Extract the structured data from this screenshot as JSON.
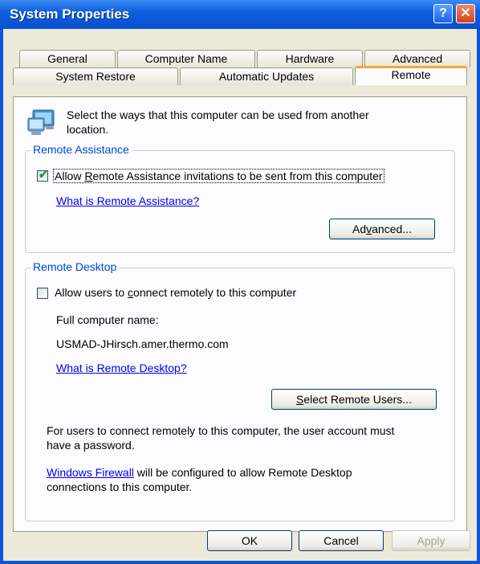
{
  "window": {
    "title": "System Properties",
    "help_glyph": "?",
    "close_glyph": "✕"
  },
  "tabs_row1": [
    {
      "label": "General"
    },
    {
      "label": "Computer Name"
    },
    {
      "label": "Hardware"
    },
    {
      "label": "Advanced"
    }
  ],
  "tabs_row2": [
    {
      "label": "System Restore"
    },
    {
      "label": "Automatic Updates"
    },
    {
      "label": "Remote",
      "selected": true
    }
  ],
  "intro": {
    "line1": "Select the ways that this computer can be used from another",
    "line2": "location.",
    "icon": "remote-computer-icon"
  },
  "remote_assistance": {
    "group_label": "Remote Assistance",
    "checkbox_pre": "Allow ",
    "checkbox_mn": "R",
    "checkbox_post": "emote Assistance invitations to be sent from this computer",
    "checked": true,
    "link": "What is Remote Assistance?",
    "advanced_pre": "Ad",
    "advanced_mn": "v",
    "advanced_post": "anced..."
  },
  "remote_desktop": {
    "group_label": "Remote Desktop",
    "checkbox_pre": "Allow users to ",
    "checkbox_mn": "c",
    "checkbox_post": "onnect remotely to this computer",
    "checked": false,
    "full_name_label": "Full computer name:",
    "full_name_value": "USMAD-JHirsch.amer.thermo.com",
    "link": "What is Remote Desktop?",
    "select_pre": "",
    "select_mn": "S",
    "select_post": "elect Remote Users...",
    "note_line1": "For users to connect remotely to this computer, the user account must",
    "note_line2": "have a password.",
    "firewall_link": "Windows Firewall",
    "firewall_rest": " will be configured to allow Remote Desktop",
    "firewall_line2": "connections to this computer."
  },
  "footer": {
    "ok": "OK",
    "cancel": "Cancel",
    "apply": "Apply"
  },
  "colors": {
    "title_bar": "#0a56d8",
    "group_label": "#0046d5",
    "tab_highlight": "#f3a83a",
    "face": "#ece9d8"
  }
}
